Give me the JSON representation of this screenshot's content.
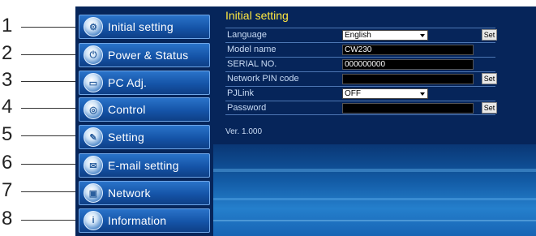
{
  "callouts": [
    "1",
    "2",
    "3",
    "4",
    "5",
    "6",
    "7",
    "8"
  ],
  "sidebar": {
    "items": [
      {
        "label": "Initial setting",
        "icon": "setup-icon",
        "glyph": "⚙"
      },
      {
        "label": "Power & Status",
        "icon": "power-icon",
        "glyph": "⏻"
      },
      {
        "label": "PC Adj.",
        "icon": "monitor-icon",
        "glyph": "▭"
      },
      {
        "label": "Control",
        "icon": "control-icon",
        "glyph": "◎"
      },
      {
        "label": "Setting",
        "icon": "wrench-icon",
        "glyph": "✎"
      },
      {
        "label": "E-mail setting",
        "icon": "envelope-icon",
        "glyph": "✉"
      },
      {
        "label": "Network",
        "icon": "network-icon",
        "glyph": "▣"
      },
      {
        "label": "Information",
        "icon": "info-icon",
        "glyph": "i"
      }
    ]
  },
  "content": {
    "title": "Initial setting",
    "rows": {
      "language": {
        "label": "Language",
        "value": "English",
        "button": "Set"
      },
      "model_name": {
        "label": "Model name",
        "value": "CW230"
      },
      "serial_no": {
        "label": "SERIAL NO.",
        "value": "000000000"
      },
      "network_pin": {
        "label": "Network PIN code",
        "value": "",
        "button": "Set"
      },
      "pjlink": {
        "label": "PJLink",
        "value": "OFF"
      },
      "password": {
        "label": "Password",
        "value": "",
        "button": "Set"
      }
    },
    "version": "Ver. 1.000"
  }
}
